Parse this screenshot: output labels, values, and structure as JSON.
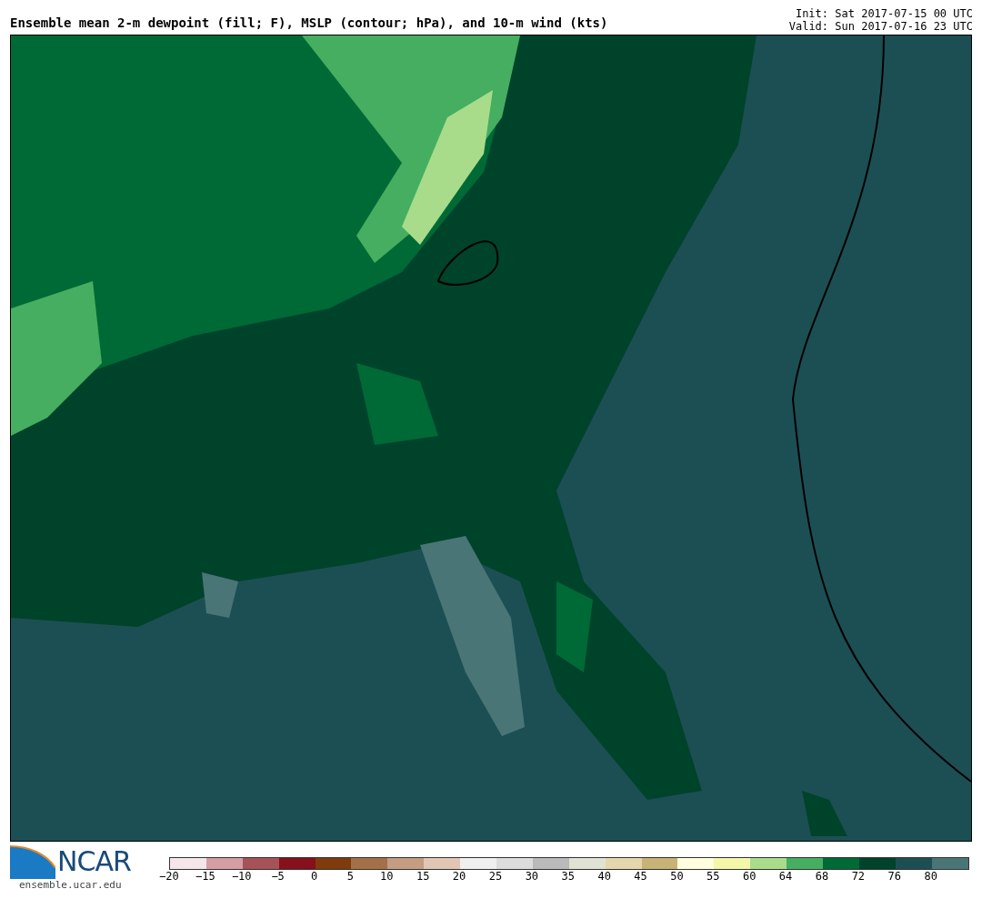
{
  "title": "Ensemble mean 2-m dewpoint (fill; F), MSLP (contour; hPa), and 10-m wind (kts)",
  "init": "Init: Sat 2017-07-15 00 UTC",
  "valid": "Valid: Sun 2017-07-16 23 UTC",
  "logo": {
    "name": "NCAR",
    "url": "ensemble.ucar.edu"
  },
  "colorbar": {
    "segments": [
      {
        "color": "#f5e6ea"
      },
      {
        "color": "#d49ea4"
      },
      {
        "color": "#a65257"
      },
      {
        "color": "#86101c"
      },
      {
        "color": "#7f3b0c"
      },
      {
        "color": "#a4704a"
      },
      {
        "color": "#c49d82"
      },
      {
        "color": "#e2c6b4"
      },
      {
        "color": "#efefef"
      },
      {
        "color": "#dcdcdc"
      },
      {
        "color": "#bababa"
      },
      {
        "color": "#e0e2d3"
      },
      {
        "color": "#e5d6ac"
      },
      {
        "color": "#c9b275"
      },
      {
        "color": "#ffffdf"
      },
      {
        "color": "#f4f7a8"
      },
      {
        "color": "#a8dc8b"
      },
      {
        "color": "#46ae60"
      },
      {
        "color": "#006a36"
      },
      {
        "color": "#00432b"
      },
      {
        "color": "#1c4f54"
      },
      {
        "color": "#4a7577"
      }
    ],
    "ticks": [
      "−20",
      "−15",
      "−10",
      "−5",
      "0",
      "5",
      "10",
      "15",
      "20",
      "25",
      "30",
      "35",
      "40",
      "45",
      "50",
      "55",
      "60",
      "64",
      "68",
      "72",
      "76",
      "80"
    ]
  }
}
